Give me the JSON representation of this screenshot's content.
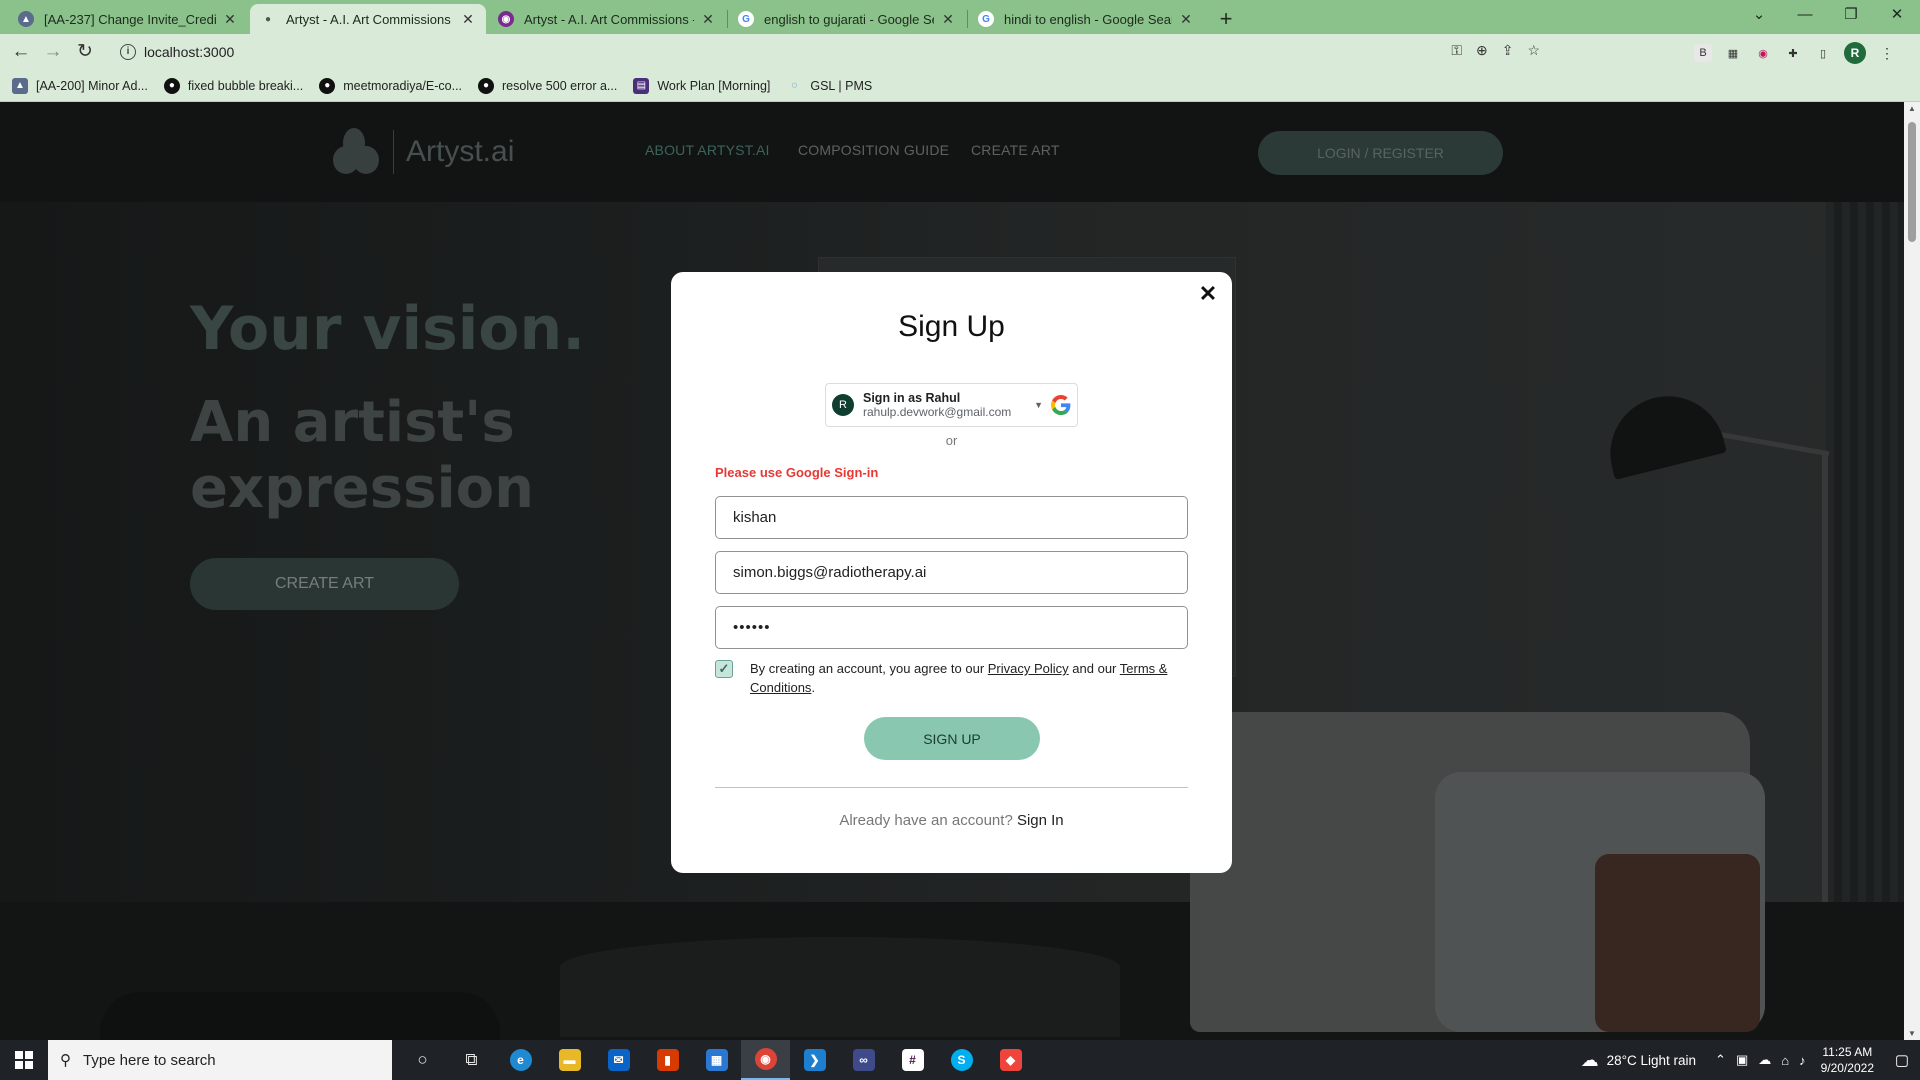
{
  "browser": {
    "tabs": [
      {
        "title": "[AA-237] Change Invite_Credits t",
        "active": false
      },
      {
        "title": "Artyst - A.I. Art Commissions",
        "active": true
      },
      {
        "title": "Artyst - A.I. Art Commissions - A",
        "active": false
      },
      {
        "title": "english to gujarati - Google Sear",
        "active": false
      },
      {
        "title": "hindi to english - Google Search",
        "active": false
      }
    ],
    "url": "localhost:3000",
    "bookmarks": [
      "[AA-200] Minor Ad...",
      "fixed bubble breaki...",
      "meetmoradiya/E-co...",
      "resolve 500 error a...",
      "Work Plan [Morning]",
      "GSL | PMS"
    ],
    "profile_initial": "R"
  },
  "site": {
    "logo_text": "Artyst.ai",
    "nav": [
      "ABOUT ARTYST.AI",
      "COMPOSITION GUIDE",
      "CREATE ART"
    ],
    "login_label": "LOGIN / REGISTER",
    "hero_line1": "Your vision.",
    "hero_line2": "An artist's expression",
    "hero_cta": "CREATE ART"
  },
  "modal": {
    "title": "Sign Up",
    "google": {
      "avatar_initial": "R",
      "name_line": "Sign in as Rahul",
      "email": "rahulp.devwork@gmail.com"
    },
    "or_text": "or",
    "error": "Please use Google Sign-in",
    "name_value": "kishan",
    "email_value": "simon.biggs@radiotherapy.ai",
    "password_value": "••••••",
    "terms_prefix": "By creating an account, you agree to our ",
    "privacy_link": "Privacy Policy",
    "terms_mid": " and our ",
    "terms_link": "Terms & Conditions",
    "terms_suffix": ".",
    "submit_label": "SIGN UP",
    "already_text": "Already have an account?",
    "signin_link": "Sign In"
  },
  "taskbar": {
    "search_placeholder": "Type here to search",
    "weather": "28°C  Light rain",
    "time": "11:25 AM",
    "date": "9/20/2022"
  },
  "colors": {
    "accent_green": "#8ac7b1",
    "error_red": "#e53935",
    "tab_green": "#8bc28b"
  }
}
